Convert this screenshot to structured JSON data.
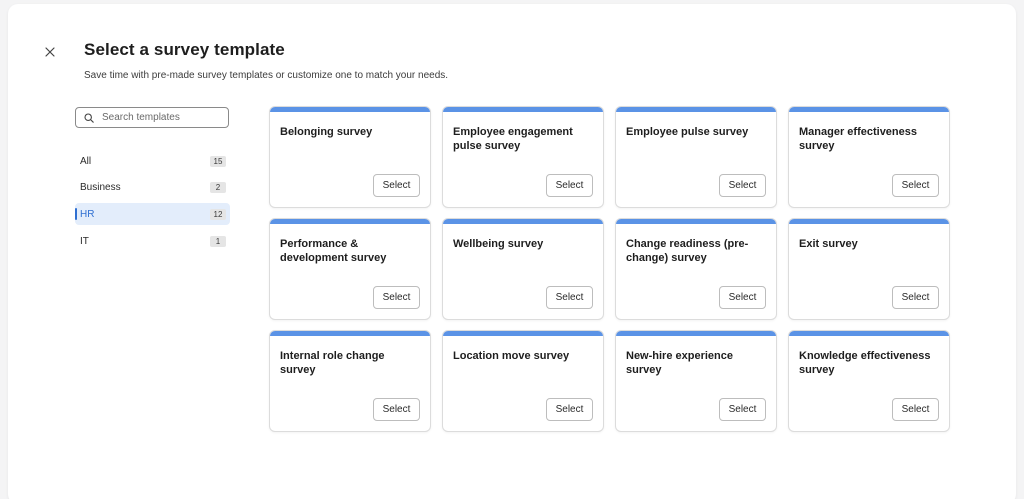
{
  "dialog": {
    "title": "Select a survey template",
    "subtitle": "Save time with pre-made survey templates or customize one to match your needs."
  },
  "search": {
    "placeholder": "Search templates",
    "value": ""
  },
  "categories": [
    {
      "label": "All",
      "count": "15",
      "active": false
    },
    {
      "label": "Business",
      "count": "2",
      "active": false
    },
    {
      "label": "HR",
      "count": "12",
      "active": true
    },
    {
      "label": "IT",
      "count": "1",
      "active": false
    }
  ],
  "templates": [
    {
      "title": "Belonging survey"
    },
    {
      "title": "Employee engagement pulse survey"
    },
    {
      "title": "Employee pulse survey"
    },
    {
      "title": "Manager effectiveness survey"
    },
    {
      "title": "Performance & development survey"
    },
    {
      "title": "Wellbeing survey"
    },
    {
      "title": "Change readiness (pre-change) survey"
    },
    {
      "title": "Exit survey"
    },
    {
      "title": "Internal role change survey"
    },
    {
      "title": "Location move survey"
    },
    {
      "title": "New-hire experience survey"
    },
    {
      "title": "Knowledge effectiveness survey"
    }
  ],
  "select_label": "Select",
  "colors": {
    "accent": "#5b93e6",
    "active_text": "#2f6fd1",
    "active_bg": "#e3edfb"
  },
  "icons": {
    "close": "close-icon",
    "search": "search-icon"
  }
}
